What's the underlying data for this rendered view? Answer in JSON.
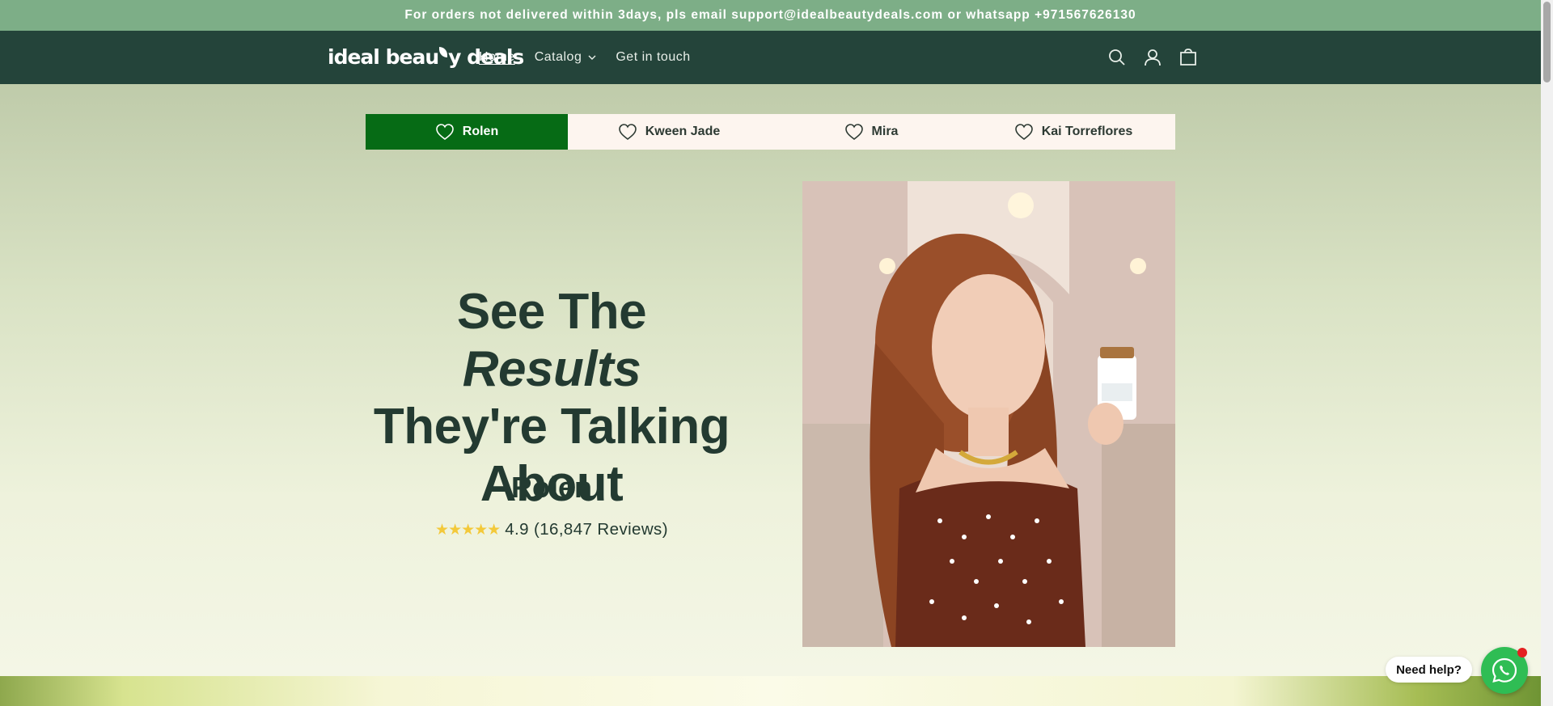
{
  "announcement": "For orders not delivered within 3days, pls email support@idealbeautydeals.com or whatsapp +971567626130",
  "header": {
    "logo": "ideal beauty deals",
    "nav": [
      "Home",
      "Catalog",
      "Get in touch"
    ]
  },
  "tabs": [
    "Rolen",
    "Kween Jade",
    "Mira",
    "Kai Torreflores"
  ],
  "hero": {
    "headline_part1": "See The",
    "headline_italic": "Results",
    "headline_part2": "They're Talking",
    "headline_part3": "About",
    "name": "Rolen",
    "stars": "★★★★★",
    "rating_text": "4.9 (16,847 Reviews)"
  },
  "chat": {
    "help_label": "Need help?"
  },
  "colors": {
    "announcement_bg": "#7dae87",
    "header_bg": "#24443a",
    "tab_active_bg": "#066b15",
    "tab_bg": "#fdf5ef",
    "heading": "#233a31",
    "whatsapp": "#2fbd54"
  },
  "icons": [
    "search-icon",
    "account-icon",
    "cart-icon",
    "chevron-down-icon",
    "heart-icon",
    "whatsapp-icon"
  ]
}
